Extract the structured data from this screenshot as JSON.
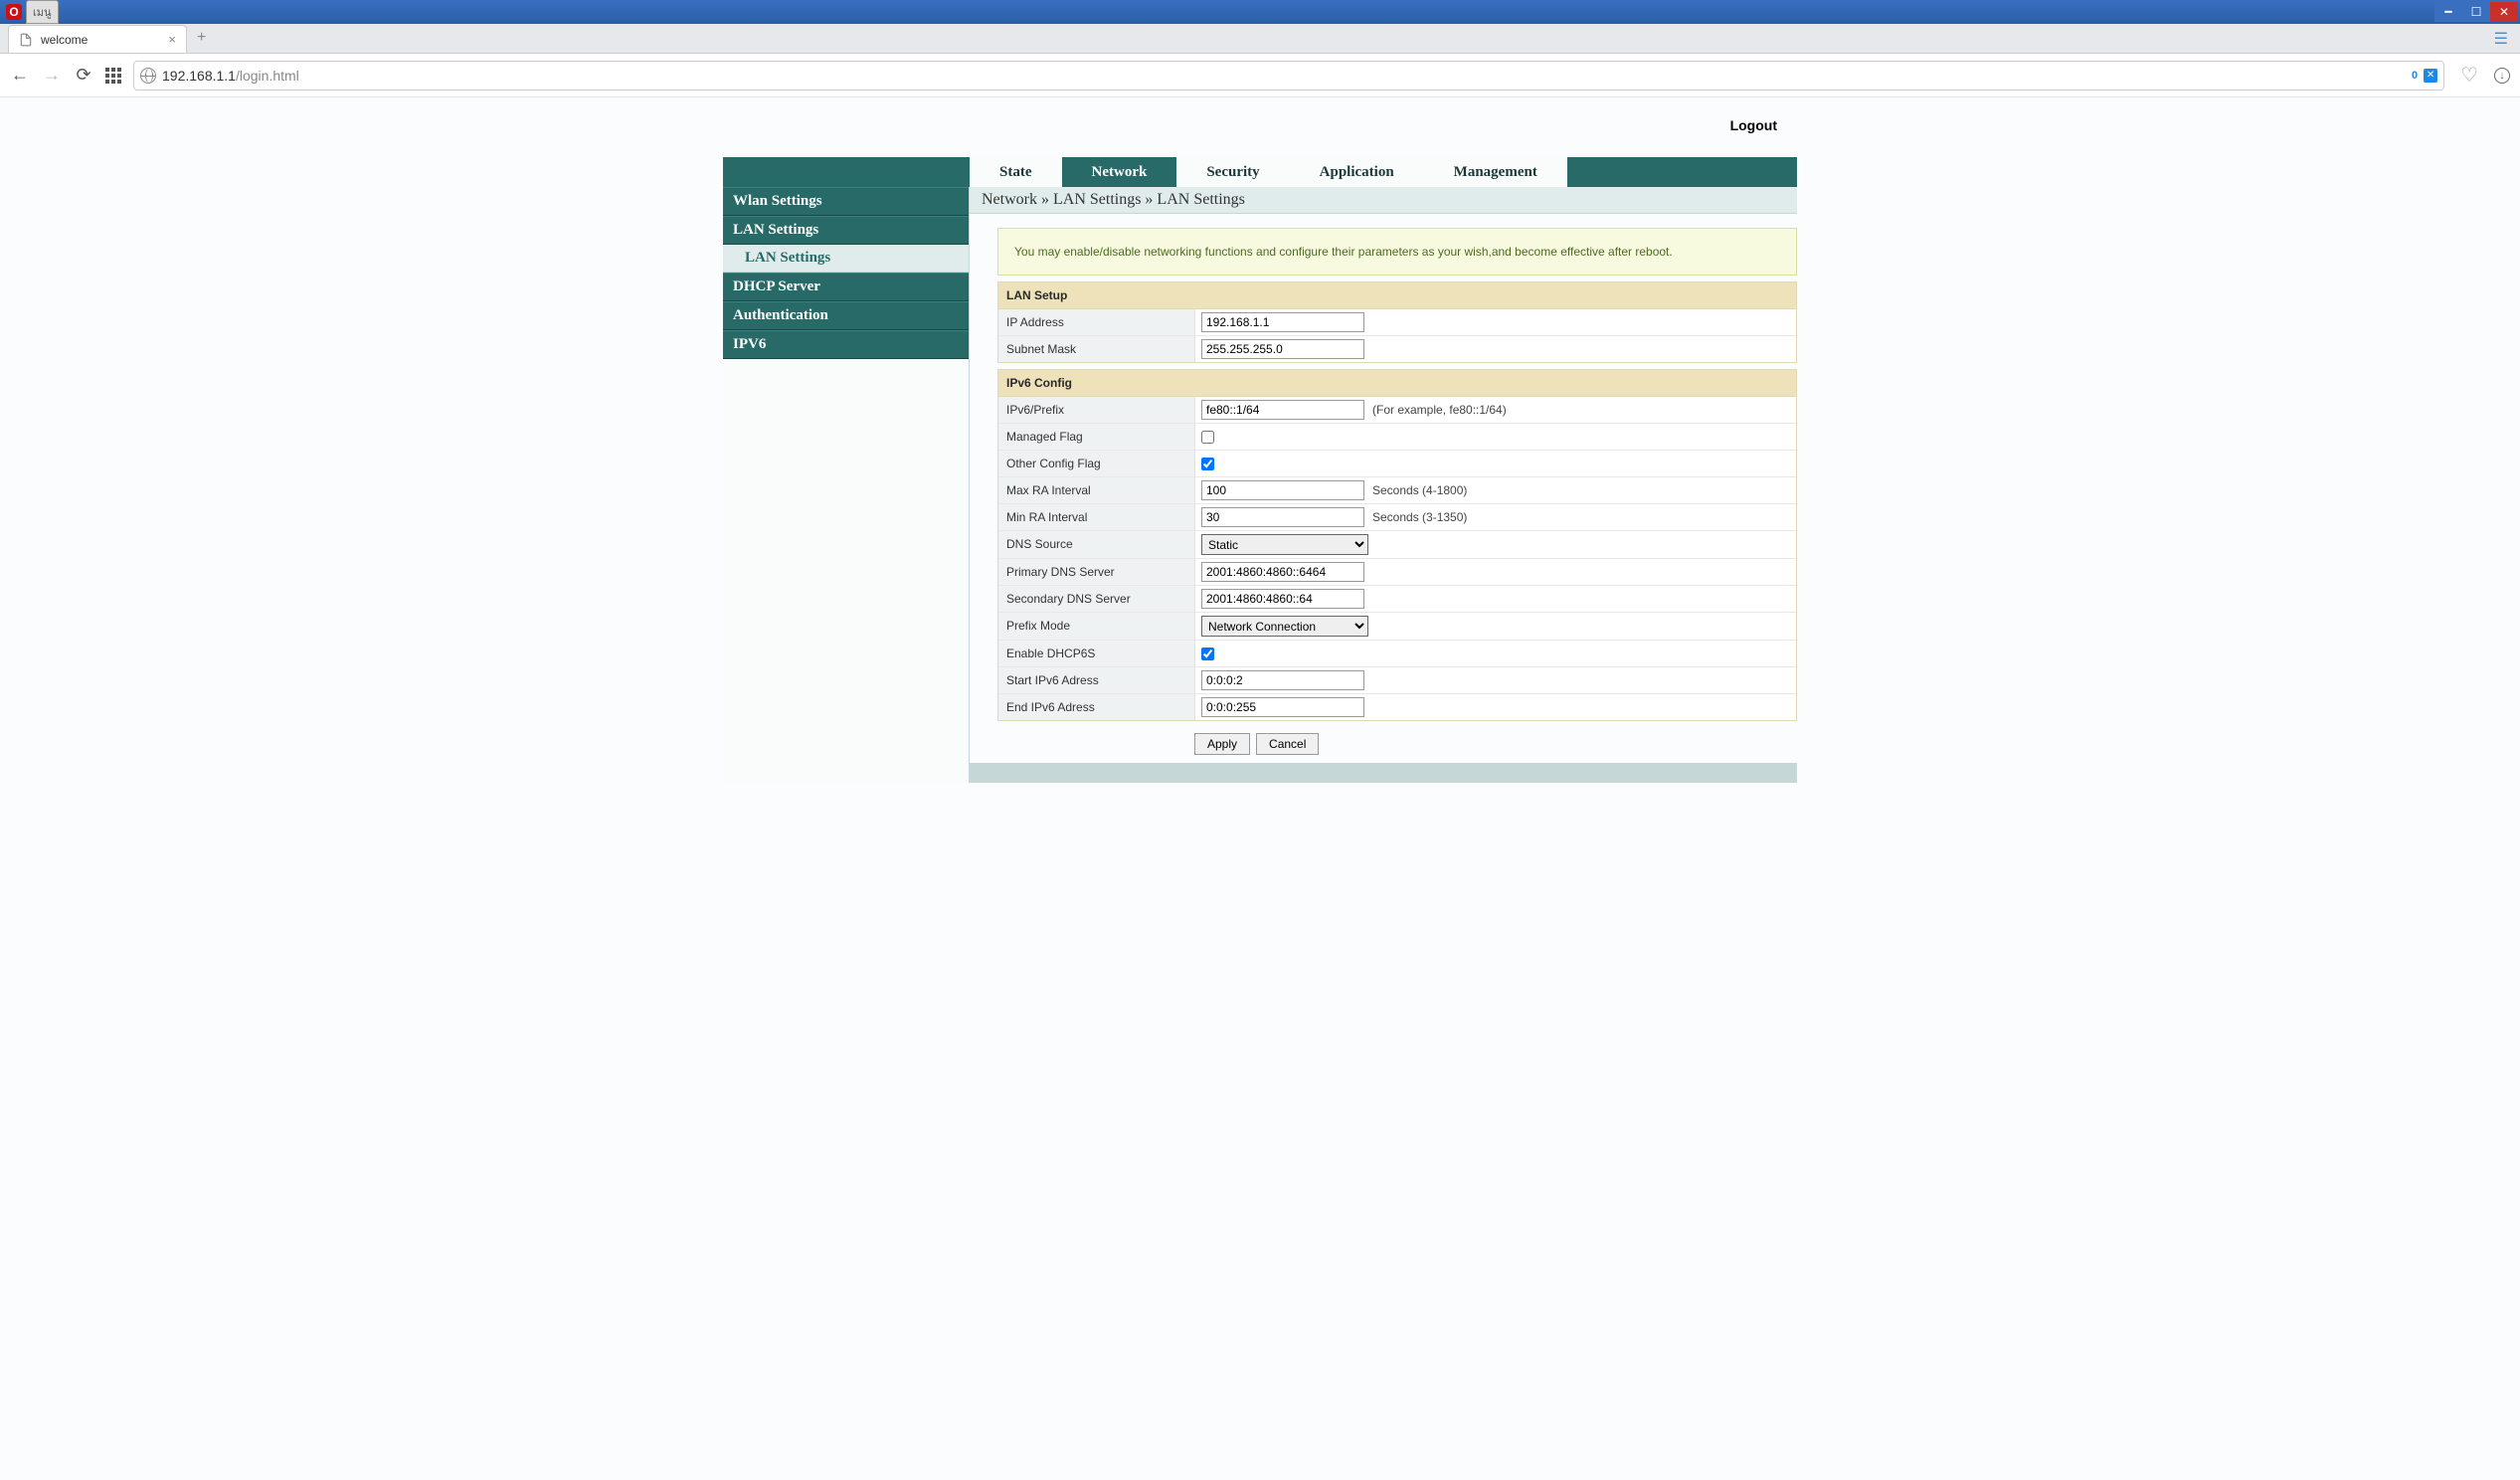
{
  "chrome": {
    "menu_label": "เมนู",
    "tab_title": "welcome",
    "url_host": "192.168.1.1",
    "url_path": "/login.html",
    "badge_zero": "0"
  },
  "page": {
    "logout": "Logout",
    "tabs": [
      "State",
      "Network",
      "Security",
      "Application",
      "Management"
    ],
    "active_tab": "Network",
    "sidebar": {
      "items": [
        "Wlan Settings",
        "LAN Settings",
        "DHCP Server",
        "Authentication",
        "IPV6"
      ],
      "subitem": "LAN Settings"
    },
    "breadcrumb": "Network » LAN Settings » LAN Settings",
    "info": "You may enable/disable networking functions and configure their parameters as your wish,and become effective after reboot.",
    "lan_setup": {
      "title": "LAN Setup",
      "ip_label": "IP Address",
      "ip_value": "192.168.1.1",
      "mask_label": "Subnet Mask",
      "mask_value": "255.255.255.0"
    },
    "ipv6": {
      "title": "IPv6 Config",
      "prefix_label": "IPv6/Prefix",
      "prefix_value": "fe80::1/64",
      "prefix_hint": "(For example, fe80::1/64)",
      "managed_label": "Managed Flag",
      "other_label": "Other Config Flag",
      "maxra_label": "Max RA Interval",
      "maxra_value": "100",
      "maxra_hint": "Seconds (4-1800)",
      "minra_label": "Min RA Interval",
      "minra_value": "30",
      "minra_hint": "Seconds (3-1350)",
      "dns_label": "DNS Source",
      "dns_value": "Static",
      "pdns_label": "Primary DNS Server",
      "pdns_value": "2001:4860:4860::6464",
      "sdns_label": "Secondary DNS Server",
      "sdns_value": "2001:4860:4860::64",
      "pmode_label": "Prefix Mode",
      "pmode_value": "Network Connection",
      "dhcp6s_label": "Enable DHCP6S",
      "start_label": "Start IPv6 Adress",
      "start_value": "0:0:0:2",
      "end_label": "End IPv6 Adress",
      "end_value": "0:0:0:255"
    },
    "buttons": {
      "apply": "Apply",
      "cancel": "Cancel"
    }
  }
}
